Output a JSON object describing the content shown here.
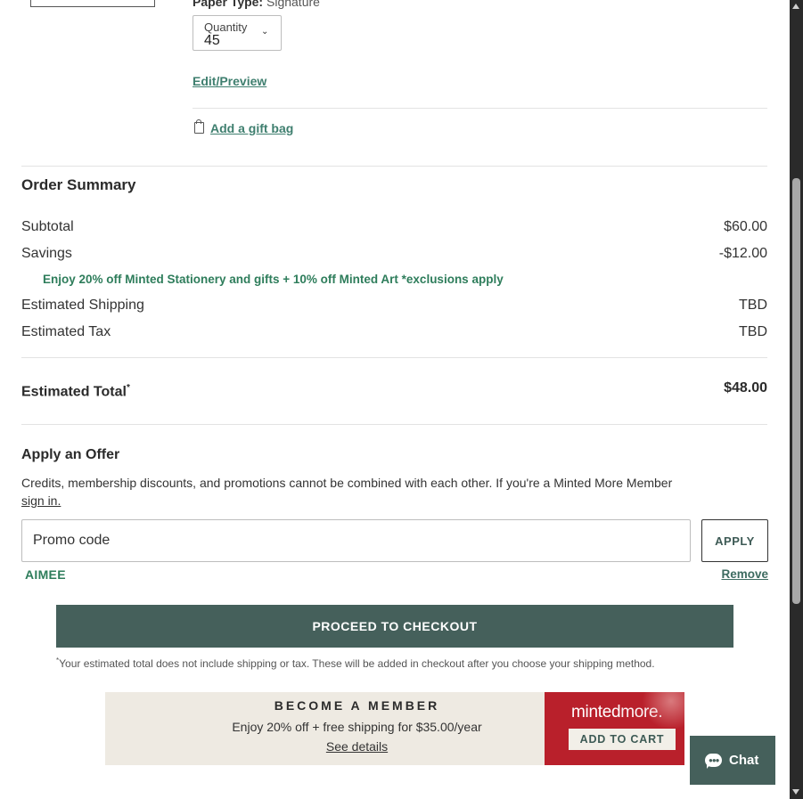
{
  "product": {
    "paper_type_label": "Paper Type:",
    "paper_type_value": "Signature",
    "quantity_label": "Quantity",
    "quantity_value": "45",
    "edit_preview": "Edit/Preview",
    "add_gift_bag": "Add a gift bag"
  },
  "order_summary": {
    "title": "Order Summary",
    "subtotal_label": "Subtotal",
    "subtotal_value": "$60.00",
    "savings_label": "Savings",
    "savings_value": "-$12.00",
    "promo_note": "Enjoy 20% off Minted Stationery and gifts + 10% off Minted Art *exclusions apply",
    "shipping_label": "Estimated Shipping",
    "shipping_value": "TBD",
    "tax_label": "Estimated Tax",
    "tax_value": "TBD",
    "total_label": "Estimated Total",
    "total_marker": "*",
    "total_value": "$48.00"
  },
  "offer": {
    "title": "Apply an Offer",
    "description": "Credits, membership discounts, and promotions cannot be combined with each other. If you're a Minted More Member",
    "signin_link": "sign in.",
    "promo_placeholder": "Promo code",
    "apply_label": "APPLY",
    "applied_code": "AIMEE",
    "remove_label": "Remove"
  },
  "checkout": {
    "button_label": "PROCEED TO CHECKOUT",
    "disclaimer_marker": "*",
    "disclaimer": "Your estimated total does not include shipping or tax. These will be added in checkout after you choose your shipping method."
  },
  "membership": {
    "title": "BECOME A MEMBER",
    "subtitle": "Enjoy 20% off + free shipping for $35.00/year",
    "details_link": "See details",
    "logo_minted": "minted",
    "logo_more": "more.",
    "cart_label": "ADD TO CART"
  },
  "chat": {
    "label": "Chat"
  },
  "colors": {
    "accent": "#45605b",
    "promo_green": "#2e7d5b",
    "brand_red": "#b9202b"
  }
}
